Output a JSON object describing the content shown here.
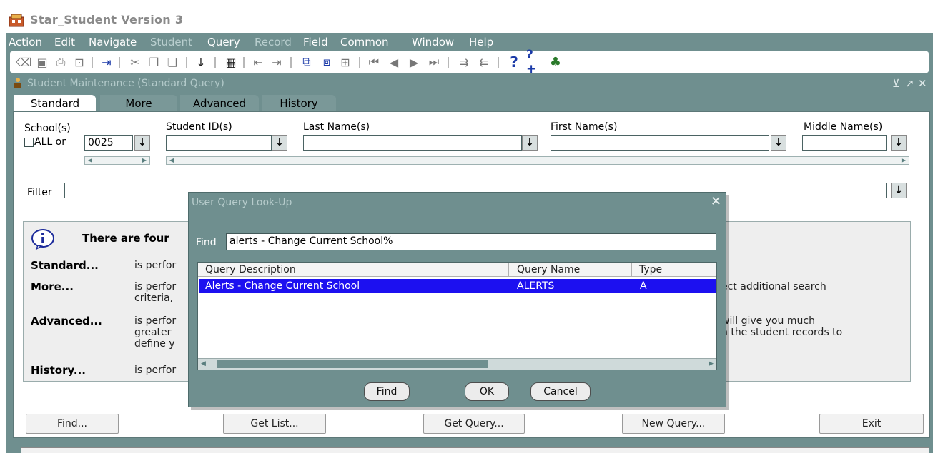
{
  "window": {
    "title": "Star_Student Version 3"
  },
  "menu": [
    {
      "label": "Action",
      "enabled": true
    },
    {
      "label": "Edit",
      "enabled": true
    },
    {
      "label": "Navigate",
      "enabled": true
    },
    {
      "label": "Student",
      "enabled": false
    },
    {
      "label": "Query",
      "enabled": true
    },
    {
      "label": "Record",
      "enabled": false
    },
    {
      "label": "Field",
      "enabled": true
    },
    {
      "label": "Common",
      "enabled": true
    },
    {
      "label": "Window",
      "enabled": true
    },
    {
      "label": "Help",
      "enabled": true
    }
  ],
  "form": {
    "title": "Student Maintenance (Standard Query)",
    "controls": "⪦ ↗ ✕"
  },
  "tabs": [
    "Standard",
    "More",
    "Advanced",
    "History"
  ],
  "fields": {
    "school_label": "School(s)",
    "all_label": "ALL or",
    "school_value": "0025",
    "student_id_label": "Student ID(s)",
    "last_name_label": "Last Name(s)",
    "first_name_label": "First Name(s)",
    "middle_name_label": "Middle Name(s)",
    "filter_label": "Filter",
    "down_arrow": "↓"
  },
  "info": {
    "heading": "There are four",
    "items": [
      {
        "term": "Standard...",
        "text": "is perfor"
      },
      {
        "term": "More...",
        "text": "is perfor\ncriteria,",
        "right": "ect additional search"
      },
      {
        "term": "Advanced...",
        "text": "is perfor\ngreater  \ndefine y",
        "right": "will give you much\nn the student records to"
      },
      {
        "term": "History...",
        "text": "is perfor"
      }
    ]
  },
  "buttons": {
    "find": "Find...",
    "get_list": "Get List...",
    "get_query": "Get Query...",
    "new_query": "New Query...",
    "exit": "Exit"
  },
  "dialog": {
    "title": "User Query Look-Up",
    "find_label": "Find",
    "find_value": "alerts - Change Current School%",
    "columns": [
      "Query Description",
      "Query Name",
      "Type"
    ],
    "rows": [
      {
        "description": "Alerts - Change Current School",
        "name": "ALERTS",
        "type": "A"
      }
    ],
    "find_button": "Find",
    "ok_button": "OK",
    "cancel_button": "Cancel"
  },
  "colors": {
    "frame": "#6f8f8f",
    "selection": "#1c10f0"
  }
}
